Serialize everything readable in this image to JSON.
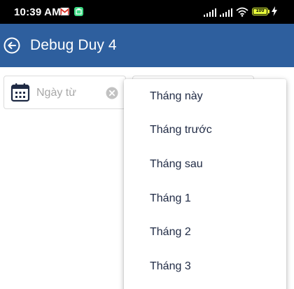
{
  "status_bar": {
    "time": "10:39 AM",
    "battery_text": "100"
  },
  "app_bar": {
    "title": "Debug Duy 4"
  },
  "filter": {
    "date_from_placeholder": "Ngày từ"
  },
  "dropdown": {
    "items": [
      {
        "label": "Tháng này"
      },
      {
        "label": "Tháng trước"
      },
      {
        "label": "Tháng sau"
      },
      {
        "label": "Tháng 1"
      },
      {
        "label": "Tháng 2"
      },
      {
        "label": "Tháng 3"
      }
    ]
  }
}
